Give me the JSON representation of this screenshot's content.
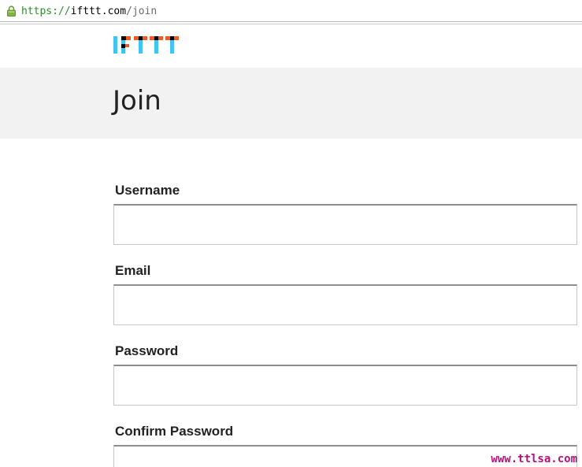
{
  "browser": {
    "url_scheme": "https://",
    "url_host": "ifttt.com",
    "url_path": "/join"
  },
  "header": {
    "logo_text": "IFTTT",
    "logo_colors": [
      "#41c4f2",
      "#f15a22",
      "#000000"
    ]
  },
  "main": {
    "title": "Join",
    "fields": [
      {
        "label": "Username",
        "value": "",
        "type": "text"
      },
      {
        "label": "Email",
        "value": "",
        "type": "email"
      },
      {
        "label": "Password",
        "value": "",
        "type": "password"
      },
      {
        "label": "Confirm Password",
        "value": "",
        "type": "password"
      }
    ]
  },
  "watermark": "www.ttlsa.com",
  "colors": {
    "title_band": "#f2f2f2",
    "url_secure": "#2f8a2f",
    "watermark": "#b4127a"
  }
}
